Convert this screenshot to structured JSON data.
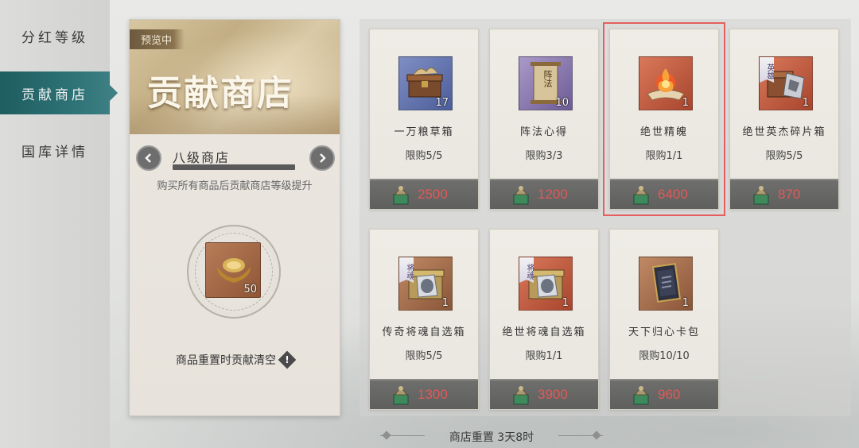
{
  "sidebar": {
    "items": [
      {
        "label": "分红等级",
        "active": false
      },
      {
        "label": "贡献商店",
        "active": true
      },
      {
        "label": "国库详情",
        "active": false
      }
    ]
  },
  "shop": {
    "preview_tag": "预览中",
    "banner_title": "贡献商店",
    "level_name": "八级商店",
    "level_hint": "购买所有商品后贡献商店等级提升",
    "currency_count": "50",
    "currency_icon": "gold-ingot-icon",
    "reset_note": "商品重置时贡献清空",
    "warn_symbol": "!"
  },
  "items": [
    {
      "name": "一万粮草箱",
      "limit": "限购5/5",
      "qty": "17",
      "price": "2500",
      "tag": "",
      "rarity": "blue",
      "icon": "grain-chest-icon"
    },
    {
      "name": "阵法心得",
      "limit": "限购3/3",
      "qty": "10",
      "price": "1200",
      "tag": "",
      "rarity": "purple",
      "icon": "formation-scroll-icon",
      "scroll_text": "阵法"
    },
    {
      "name": "绝世精魄",
      "limit": "限购1/1",
      "qty": "1",
      "price": "6400",
      "tag": "",
      "rarity": "orange",
      "icon": "spirit-flame-icon",
      "selected": true
    },
    {
      "name": "绝世英杰碎片箱",
      "limit": "限购5/5",
      "qty": "1",
      "price": "870",
      "tag": "英雄",
      "rarity": "orange",
      "icon": "hero-shard-chest-icon"
    },
    {
      "name": "传奇将魂自选箱",
      "limit": "限购5/5",
      "qty": "1",
      "price": "1300",
      "tag": "将魂",
      "rarity": "copper",
      "icon": "general-soul-chest-icon"
    },
    {
      "name": "绝世将魂自选箱",
      "limit": "限购1/1",
      "qty": "1",
      "price": "3900",
      "tag": "将魂",
      "rarity": "orange",
      "icon": "general-soul-chest-icon"
    },
    {
      "name": "天下归心卡包",
      "limit": "限购10/10",
      "qty": "1",
      "price": "960",
      "tag": "",
      "rarity": "copper",
      "icon": "card-pack-icon"
    }
  ],
  "footer": {
    "reset_text": "商店重置 3天8时"
  },
  "colors": {
    "accent": "#2f7478",
    "price": "#e05a5a",
    "selection": "#e46060"
  }
}
